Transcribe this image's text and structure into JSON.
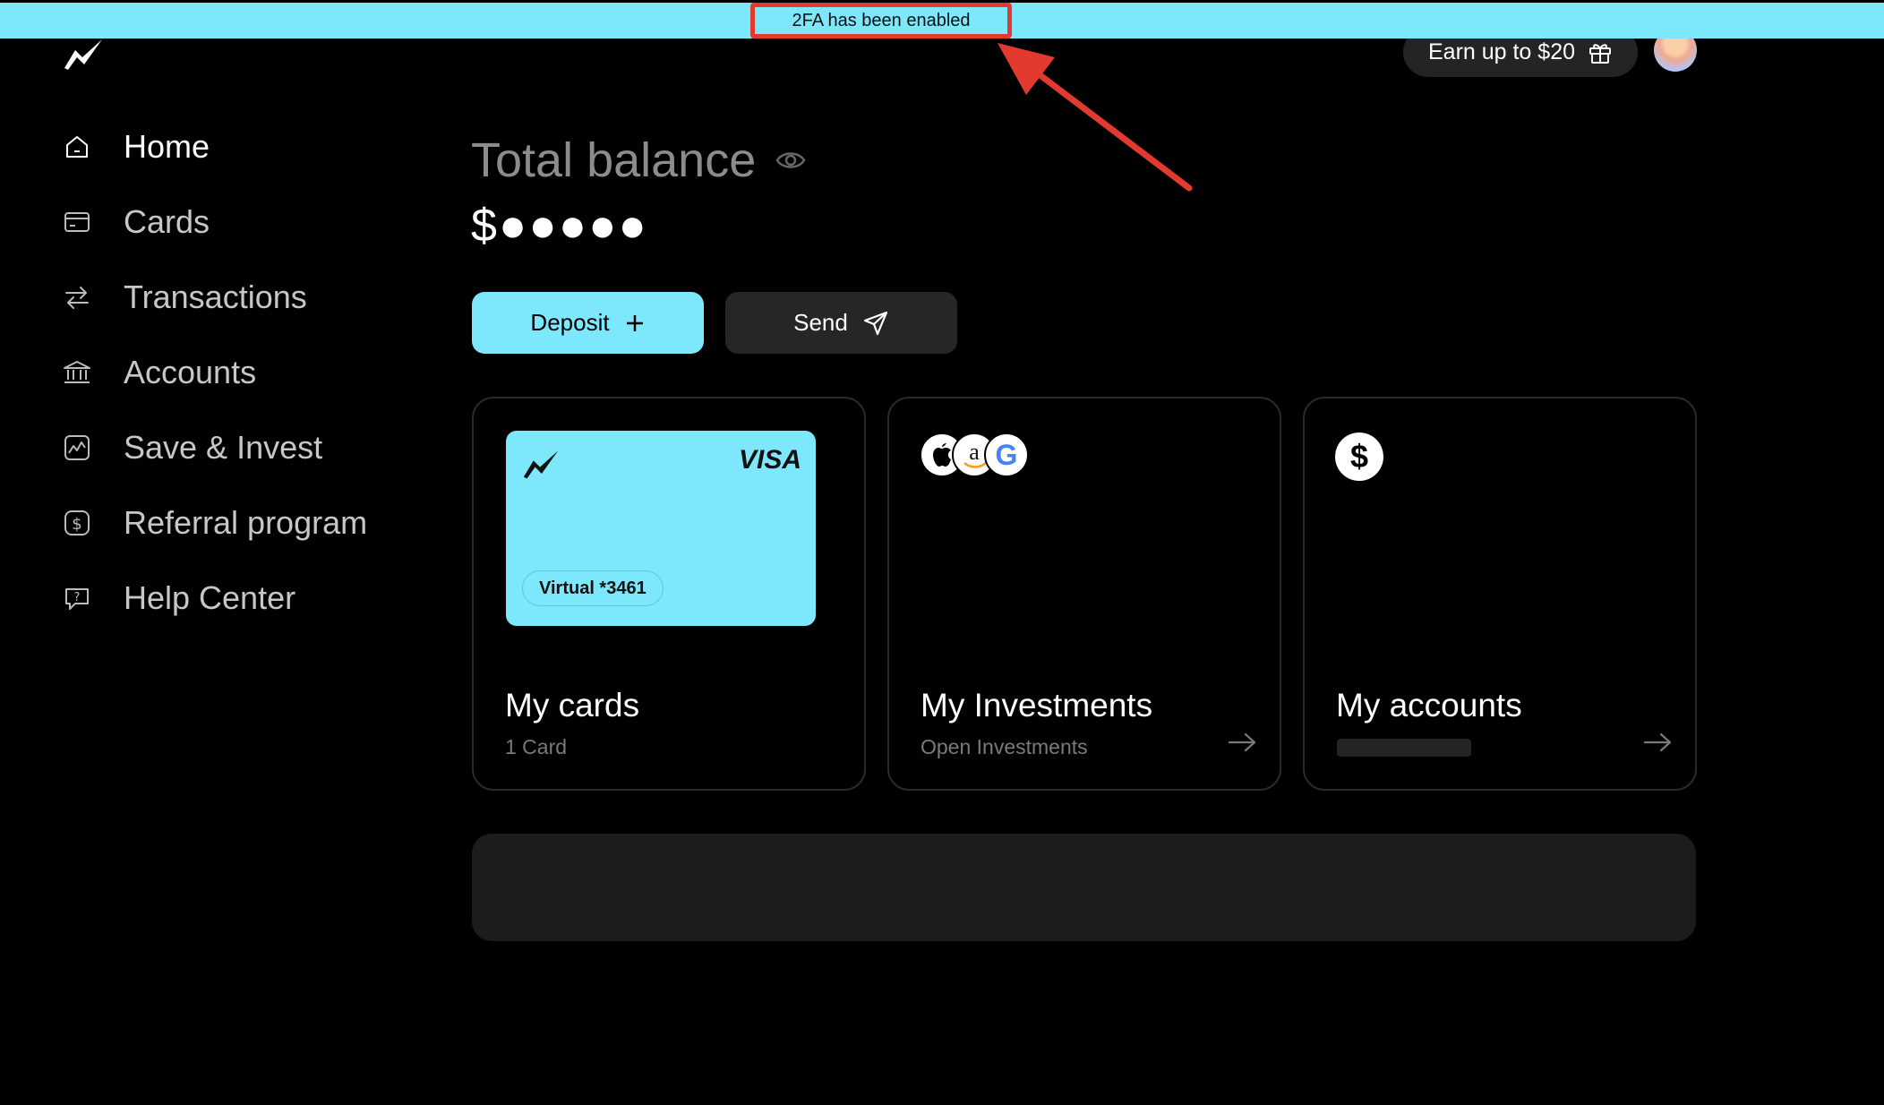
{
  "notification": {
    "text": "2FA has been enabled"
  },
  "header": {
    "earn_label": "Earn up to $20"
  },
  "sidebar": {
    "items": [
      {
        "label": "Home",
        "icon": "home-icon",
        "active": true
      },
      {
        "label": "Cards",
        "icon": "card-icon"
      },
      {
        "label": "Transactions",
        "icon": "transfer-icon"
      },
      {
        "label": "Accounts",
        "icon": "bank-icon"
      },
      {
        "label": "Save & Invest",
        "icon": "chart-icon"
      },
      {
        "label": "Referral program",
        "icon": "dollar-icon"
      },
      {
        "label": "Help Center",
        "icon": "help-chat-icon"
      }
    ]
  },
  "balance": {
    "title": "Total balance",
    "value": "$●●●●●"
  },
  "actions": {
    "deposit_label": "Deposit",
    "send_label": "Send"
  },
  "tiles": {
    "cards": {
      "title": "My cards",
      "subtitle": "1 Card",
      "card_brand": "VISA",
      "card_label": "Virtual *3461"
    },
    "investments": {
      "title": "My Investments",
      "subtitle": "Open Investments",
      "amazon_letter": "a",
      "google_letter": "G"
    },
    "accounts": {
      "title": "My accounts",
      "dollar_symbol": "$"
    }
  },
  "colors": {
    "accent": "#7de7fb",
    "annotation": "#e23a2f",
    "background": "#000000",
    "panel": "#1c1c1c"
  }
}
